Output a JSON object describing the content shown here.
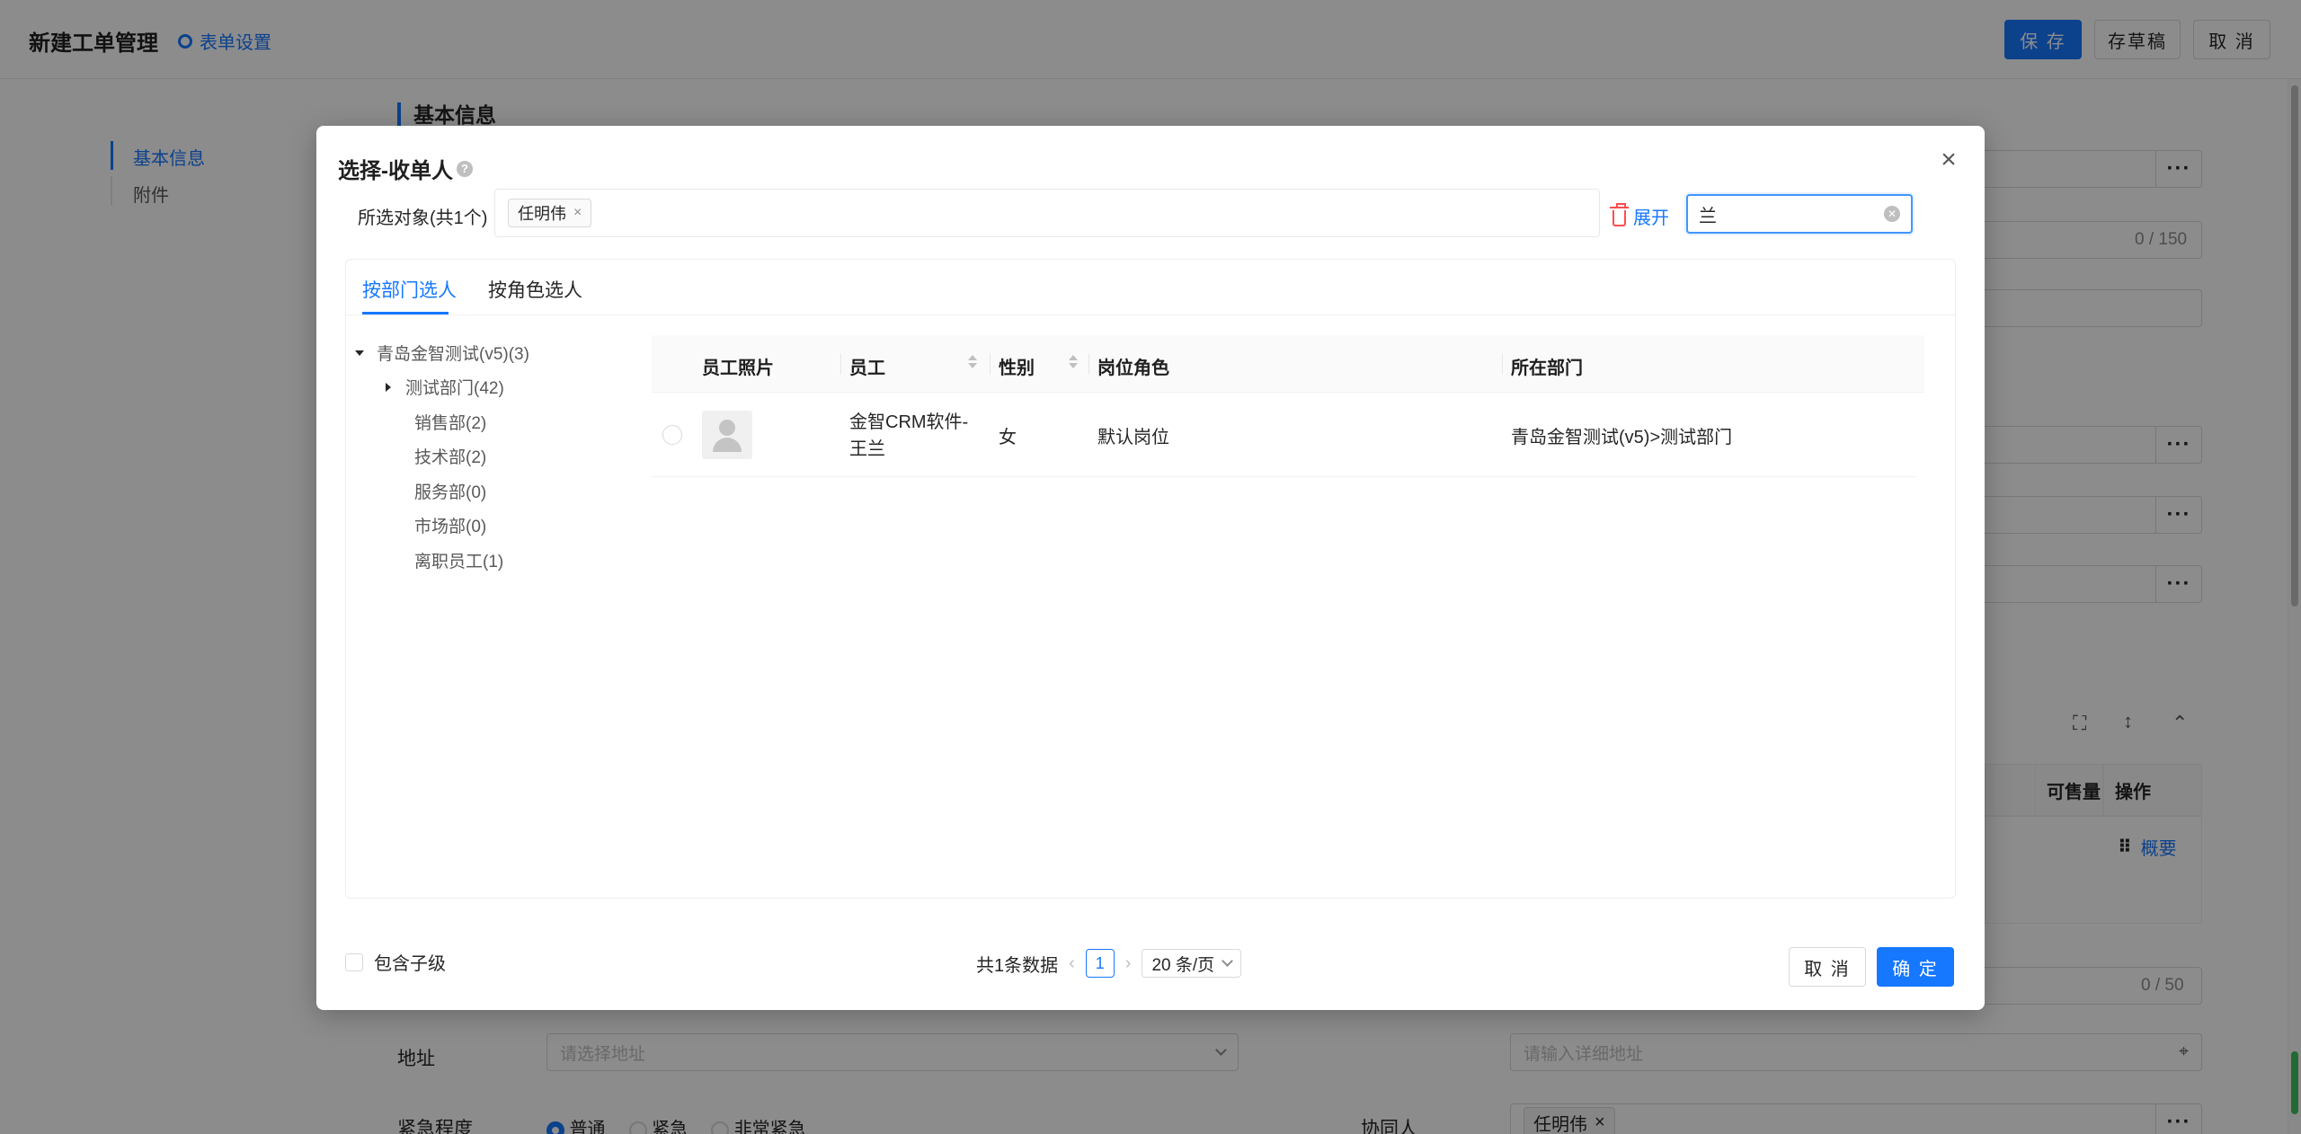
{
  "page": {
    "title": "新建工单管理",
    "form_settings": "表单设置",
    "save": "保 存",
    "draft": "存草稿",
    "cancel": "取 消",
    "nav": [
      "基本信息",
      "附件"
    ],
    "section_title": "基本信息",
    "counters": [
      "0 / 150",
      "0 / 50"
    ],
    "address_label": "地址",
    "address_placeholder": "请选择地址",
    "detail_address_placeholder": "请输入详细地址",
    "urgency_label": "紧急程度",
    "urgency_options": [
      "普通",
      "紧急",
      "非常紧急"
    ],
    "collaborator_label": "协同人",
    "collaborator_tag": "任明伟",
    "table_headers": [
      "可售量",
      "操作"
    ],
    "table_link": "概要"
  },
  "modal": {
    "title": "选择-收单人",
    "selected_label": "所选对象(共1个)",
    "selected_tags": [
      "任明伟"
    ],
    "expand": "展开",
    "search_value": "兰",
    "tabs": [
      "按部门选人",
      "按角色选人"
    ],
    "tree": {
      "root": "青岛金智测试(v5)(3)",
      "children": [
        "测试部门(42)",
        "销售部(2)",
        "技术部(2)",
        "服务部(0)",
        "市场部(0)",
        "离职员工(1)"
      ]
    },
    "columns": [
      "员工照片",
      "员工",
      "性别",
      "岗位角色",
      "所在部门"
    ],
    "rows": [
      {
        "employee_line1": "金智CRM软件-",
        "employee_line2": "王兰",
        "gender": "女",
        "role": "默认岗位",
        "department": "青岛金智测试(v5)>测试部门"
      }
    ],
    "include_children": "包含子级",
    "total": "共1条数据",
    "page": "1",
    "page_size": "20 条/页",
    "cancel": "取 消",
    "confirm": "确 定"
  },
  "colors": {
    "primary": "#1677ff",
    "danger": "#ff4d4f"
  }
}
